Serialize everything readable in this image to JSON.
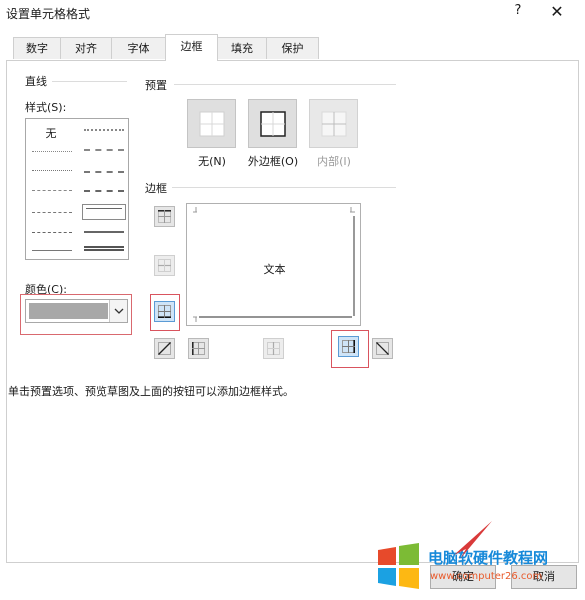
{
  "window": {
    "title": "设置单元格格式",
    "help_label": "?",
    "close_label": "✕"
  },
  "tabs": [
    "数字",
    "对齐",
    "字体",
    "边框",
    "填充",
    "保护"
  ],
  "active_tab": "边框",
  "line": {
    "heading": "直线",
    "style_label": "样式(S):",
    "none_label": "无"
  },
  "color": {
    "label": "颜色(C):",
    "value": "#a8a8a8"
  },
  "presets": {
    "heading": "预置",
    "items": [
      {
        "label": "无(N)",
        "icon": "border-none-icon"
      },
      {
        "label": "外边框(O)",
        "icon": "border-outline-icon"
      },
      {
        "label": "内部(I)",
        "icon": "border-inside-icon"
      }
    ]
  },
  "border": {
    "heading": "边框",
    "preview_text": "文本"
  },
  "hint": "单击预置选项、预览草图及上面的按钮可以添加边框样式。",
  "buttons": {
    "ok": "确定",
    "cancel": "取消"
  },
  "watermark": {
    "title": "电脑软硬件教程网",
    "url": "www.computer26.com"
  }
}
